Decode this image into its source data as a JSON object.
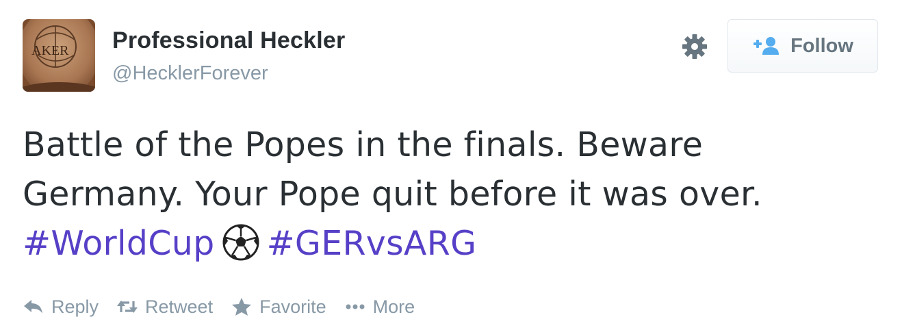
{
  "author": {
    "name": "Professional Heckler",
    "handle": "@HecklerForever",
    "avatar_icon": "avatar-shaved-head-logo",
    "avatar_text": "AKER"
  },
  "header": {
    "settings_icon": "gear-icon",
    "follow_label": "Follow",
    "follow_icon": "add-user-icon"
  },
  "tweet": {
    "line1": "Battle of the Popes in the finals. Beware",
    "line2": "Germany. Your Pope quit before it was over.",
    "hashtag1": "#WorldCup",
    "emoji": "soccer-ball-icon",
    "hashtag2": "#GERvsARG"
  },
  "actions": {
    "reply": "Reply",
    "retweet": "Retweet",
    "favorite": "Favorite",
    "more": "More"
  },
  "colors": {
    "text": "#292f33",
    "muted": "#8899a6",
    "hashtag": "#5740c7",
    "follow_accent": "#55acee"
  }
}
